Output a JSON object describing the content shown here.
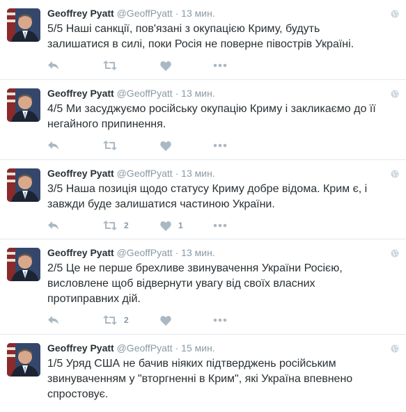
{
  "colors": {
    "icon": "#aab8c2",
    "secondary_text": "#8899a6",
    "divider": "#e1e8ed"
  },
  "icons": {
    "reply": "reply-icon",
    "retweet": "retweet-icon",
    "like": "heart-icon",
    "more": "more-icon",
    "globe": "globe-icon"
  },
  "tweets": [
    {
      "name": "Geoffrey Pyatt",
      "handle": "@GeoffPyatt",
      "dot": "·",
      "time": "13 мин.",
      "text": "5/5 Наші санкції, пов'язані з окупацією Криму, будуть залишатися в силі, поки Росія не поверне півострів Україні.",
      "retweets": "",
      "likes": ""
    },
    {
      "name": "Geoffrey Pyatt",
      "handle": "@GeoffPyatt",
      "dot": "·",
      "time": "13 мин.",
      "text": "4/5 Ми засуджуємо російську окупацію Криму і закликаємо до її негайного припинення.",
      "retweets": "",
      "likes": ""
    },
    {
      "name": "Geoffrey Pyatt",
      "handle": "@GeoffPyatt",
      "dot": "·",
      "time": "13 мин.",
      "text": "3/5 Наша позиція щодо статусу Криму добре відома. Крим є, і завжди буде залишатися частиною України.",
      "retweets": "2",
      "likes": "1"
    },
    {
      "name": "Geoffrey Pyatt",
      "handle": "@GeoffPyatt",
      "dot": "·",
      "time": "13 мин.",
      "text": "2/5 Це не перше брехливе звинувачення України Росією, висловлене щоб відвернути увагу від своїх власних протиправних дій.",
      "retweets": "2",
      "likes": ""
    },
    {
      "name": "Geoffrey Pyatt",
      "handle": "@GeoffPyatt",
      "dot": "·",
      "time": "15 мин.",
      "text": "1/5 Уряд США не бачив ніяких підтверджень російським звинуваченням у \"вторгненні в Крим\", які Україна впевнено спростовує.",
      "retweets": "",
      "likes": ""
    }
  ]
}
